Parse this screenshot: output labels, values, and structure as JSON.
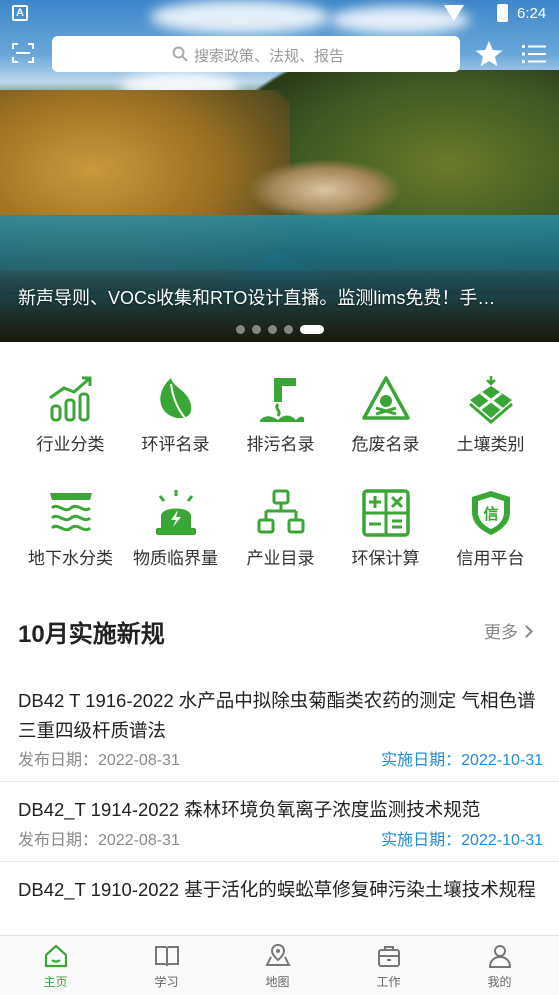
{
  "status_bar": {
    "time": "6:24",
    "battery_level": "6"
  },
  "search": {
    "placeholder": "搜索政策、法规、报告"
  },
  "banner": {
    "caption": "新声导则、VOCs收集和RTO设计直播。监测lims免费！手…",
    "dots_count": 5,
    "active_dot": 5
  },
  "categories": [
    {
      "label": "行业分类",
      "icon": "bar-growth-icon"
    },
    {
      "label": "环评名录",
      "icon": "leaf-icon"
    },
    {
      "label": "排污名录",
      "icon": "discharge-pipe-icon"
    },
    {
      "label": "危废名录",
      "icon": "hazard-triangle-icon"
    },
    {
      "label": "土壤类别",
      "icon": "soil-grid-icon"
    },
    {
      "label": "地下水分类",
      "icon": "water-waves-icon"
    },
    {
      "label": "物质临界量",
      "icon": "alarm-light-icon"
    },
    {
      "label": "产业目录",
      "icon": "org-tree-icon"
    },
    {
      "label": "环保计算",
      "icon": "calculator-icon"
    },
    {
      "label": "信用平台",
      "icon": "shield-credit-icon"
    }
  ],
  "section": {
    "title": "10月实施新规",
    "more": "更多"
  },
  "news": [
    {
      "title": "DB42 T 1916-2022 水产品中拟除虫菊酯类农药的测定 气相色谱三重四级杆质谱法",
      "published": "发布日期：2022-08-31",
      "effective": "实施日期：2022-10-31"
    },
    {
      "title": "DB42_T 1914-2022 森林环境负氧离子浓度监测技术规范",
      "published": "发布日期：2022-08-31",
      "effective": "实施日期：2022-10-31"
    },
    {
      "title": "DB42_T 1910-2022 基于活化的蜈蚣草修复砷污染土壤技术规程",
      "published": "",
      "effective": ""
    }
  ],
  "bottom_nav": [
    {
      "label": "主页",
      "icon": "home-icon",
      "active": true
    },
    {
      "label": "学习",
      "icon": "book-icon",
      "active": false
    },
    {
      "label": "地图",
      "icon": "map-pin-icon",
      "active": false
    },
    {
      "label": "工作",
      "icon": "briefcase-icon",
      "active": false
    },
    {
      "label": "我的",
      "icon": "user-icon",
      "active": false
    }
  ],
  "colors": {
    "accent_green": "#3aa635",
    "link_blue": "#1e8ee0"
  }
}
